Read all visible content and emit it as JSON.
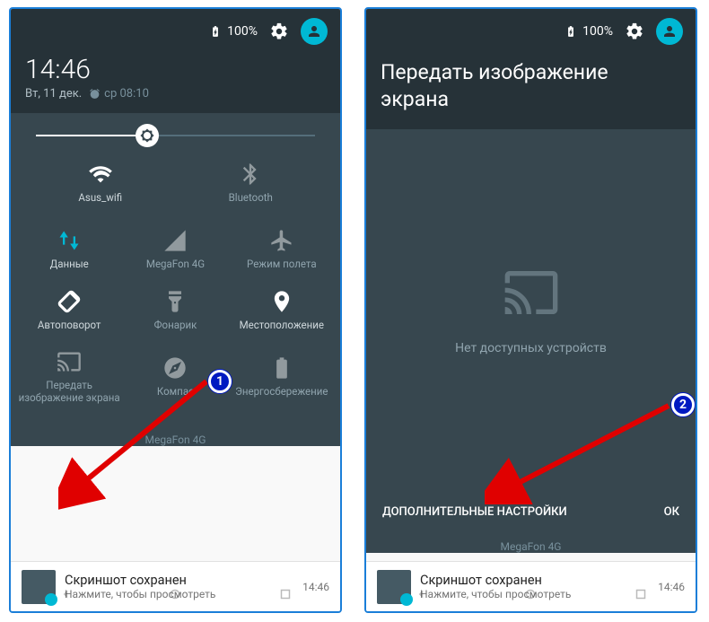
{
  "status": {
    "battery": "100%"
  },
  "left": {
    "time": "14:46",
    "date": "Вт, 11 дек.",
    "nextAlarm": "ср 08:10",
    "tilesTop": [
      {
        "label": "Asus_wifi"
      },
      {
        "label": "Bluetooth"
      }
    ],
    "tilesMid": [
      {
        "label": "Данные"
      },
      {
        "label": "MegaFon 4G"
      },
      {
        "label": "Режим полета"
      }
    ],
    "tilesLow": [
      {
        "label": "Автоповорот"
      },
      {
        "label": "Фонарик"
      },
      {
        "label": "Местоположение"
      }
    ],
    "tilesBot": [
      {
        "label": "Передать изображение экрана"
      },
      {
        "label": "Компас"
      },
      {
        "label": "Энергосбережение"
      }
    ],
    "carrier": "MegaFon 4G"
  },
  "right": {
    "title": "Передать изображение экрана",
    "empty": "Нет доступных устройств",
    "moreBtn": "ДОПОЛНИТЕЛЬНЫЕ НАСТРОЙКИ",
    "okBtn": "ОК",
    "carrier": "MegaFon 4G"
  },
  "notif": {
    "title": "Скриншот сохранен",
    "sub": "Нажмите, чтобы просмотреть",
    "time": "14:46"
  },
  "anno": {
    "n1": "1",
    "n2": "2"
  }
}
